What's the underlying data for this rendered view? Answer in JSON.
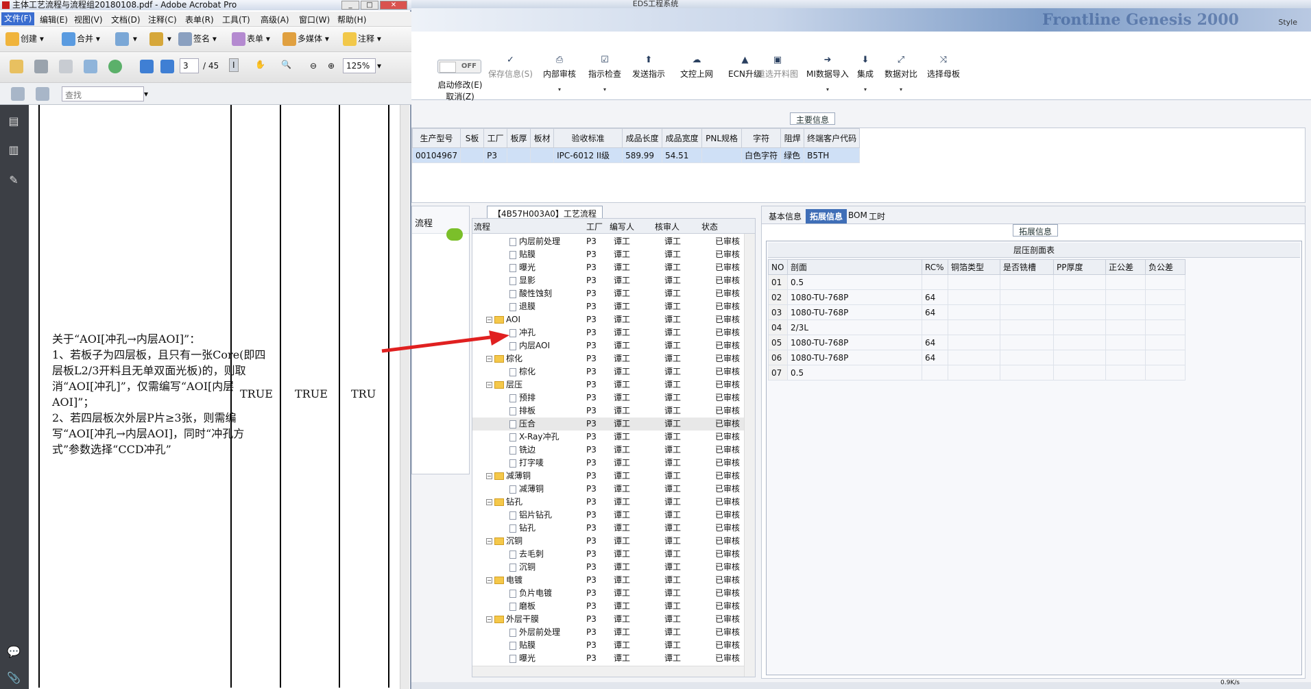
{
  "acrobat": {
    "title": "主体工艺流程与流程组20180108.pdf - Adobe Acrobat Pro",
    "menus": [
      "文件(F)",
      "编辑(E)",
      "视图(V)",
      "文档(D)",
      "注释(C)",
      "表单(R)",
      "工具(T)",
      "高级(A)",
      "窗口(W)",
      "帮助(H)"
    ],
    "toolbar1": {
      "create": "创建",
      "merge": "合并",
      "sign": "签名",
      "form": "表单",
      "multimedia": "多媒体",
      "comment": "注释"
    },
    "toolbar2": {
      "page_current": "3",
      "page_total": "/ 45",
      "zoom": "125%"
    },
    "toolbar3": {
      "find_placeholder": "查找"
    },
    "doc": {
      "text": "关于“AOI[冲孔→内层AOI]”：\n1、若板子为四层板，且只有一张Core(即四层板L2/3开料且无单双面光板)的，则取消“AOI[冲孔]”，仅需编写“AOI[内层AOI]”；\n2、若四层板次外层P片≥3张，则需编写“AOI[冲孔→内层AOI]，同时“冲孔方式”参数选择“CCD冲孔”",
      "col1": "TRUE",
      "col2": "TRUE",
      "col3": "TRU"
    }
  },
  "eds": {
    "title": "EDS工程系统",
    "banner_brand": "Frontline Genesis 2000",
    "banner_style": "Style",
    "toggle": "OFF",
    "start_modify": "启动修改(E)",
    "cancel": "取消(Z)",
    "ribbon": [
      {
        "label": "保存信息(S)",
        "disabled": true
      },
      {
        "label": "内部审核",
        "disabled": false
      },
      {
        "label": "指示检查",
        "disabled": false
      },
      {
        "label": "发送指示",
        "disabled": false
      },
      {
        "label": "文控上网",
        "disabled": false
      },
      {
        "label": "ECN升级",
        "disabled": false
      },
      {
        "label": "重选开料图",
        "disabled": true
      },
      {
        "label": "MI数据导入",
        "disabled": false
      },
      {
        "label": "集成",
        "disabled": false
      },
      {
        "label": "数据对比",
        "disabled": false
      },
      {
        "label": "选择母板",
        "disabled": false
      }
    ],
    "main_info": {
      "title": "主要信息",
      "columns": [
        "生产型号",
        "S板",
        "工厂",
        "板厚",
        "板材",
        "验收标准",
        "成品长度",
        "成品宽度",
        "PNL规格",
        "字符",
        "阻焊",
        "终端客户代码"
      ],
      "row": [
        "00104967",
        "",
        "P3",
        "",
        "",
        "IPC-6012 II级",
        "589.99",
        "54.51",
        "",
        "白色字符",
        "绿色",
        "B5TH"
      ]
    },
    "left_pane": {
      "title": "流程"
    },
    "process": {
      "tab": "【4B57H003A0】工艺流程",
      "columns": [
        "流程",
        "工厂",
        "编写人",
        "核审人",
        "状态"
      ],
      "rows": [
        {
          "name": "内层前处理",
          "group": false,
          "factory": "P3",
          "writer": "谭工",
          "reviewer": "谭工",
          "status": "已审核"
        },
        {
          "name": "贴膜",
          "group": false,
          "factory": "P3",
          "writer": "谭工",
          "reviewer": "谭工",
          "status": "已审核"
        },
        {
          "name": "曝光",
          "group": false,
          "factory": "P3",
          "writer": "谭工",
          "reviewer": "谭工",
          "status": "已审核"
        },
        {
          "name": "显影",
          "group": false,
          "factory": "P3",
          "writer": "谭工",
          "reviewer": "谭工",
          "status": "已审核"
        },
        {
          "name": "酸性蚀刻",
          "group": false,
          "factory": "P3",
          "writer": "谭工",
          "reviewer": "谭工",
          "status": "已审核"
        },
        {
          "name": "退膜",
          "group": false,
          "factory": "P3",
          "writer": "谭工",
          "reviewer": "谭工",
          "status": "已审核"
        },
        {
          "name": "AOI",
          "group": true,
          "factory": "P3",
          "writer": "谭工",
          "reviewer": "谭工",
          "status": "已审核"
        },
        {
          "name": "冲孔",
          "group": false,
          "factory": "P3",
          "writer": "谭工",
          "reviewer": "谭工",
          "status": "已审核"
        },
        {
          "name": "内层AOI",
          "group": false,
          "factory": "P3",
          "writer": "谭工",
          "reviewer": "谭工",
          "status": "已审核"
        },
        {
          "name": "棕化",
          "group": true,
          "factory": "P3",
          "writer": "谭工",
          "reviewer": "谭工",
          "status": "已审核"
        },
        {
          "name": "棕化",
          "group": false,
          "factory": "P3",
          "writer": "谭工",
          "reviewer": "谭工",
          "status": "已审核"
        },
        {
          "name": "层压",
          "group": true,
          "factory": "P3",
          "writer": "谭工",
          "reviewer": "谭工",
          "status": "已审核"
        },
        {
          "name": "预排",
          "group": false,
          "factory": "P3",
          "writer": "谭工",
          "reviewer": "谭工",
          "status": "已审核"
        },
        {
          "name": "排板",
          "group": false,
          "factory": "P3",
          "writer": "谭工",
          "reviewer": "谭工",
          "status": "已审核"
        },
        {
          "name": "压合",
          "group": false,
          "factory": "P3",
          "writer": "谭工",
          "reviewer": "谭工",
          "status": "已审核"
        },
        {
          "name": "X-Ray冲孔",
          "group": false,
          "factory": "P3",
          "writer": "谭工",
          "reviewer": "谭工",
          "status": "已审核"
        },
        {
          "name": "铣边",
          "group": false,
          "factory": "P3",
          "writer": "谭工",
          "reviewer": "谭工",
          "status": "已审核"
        },
        {
          "name": "打字唛",
          "group": false,
          "factory": "P3",
          "writer": "谭工",
          "reviewer": "谭工",
          "status": "已审核"
        },
        {
          "name": "减薄铜",
          "group": true,
          "factory": "P3",
          "writer": "谭工",
          "reviewer": "谭工",
          "status": "已审核"
        },
        {
          "name": "减薄铜",
          "group": false,
          "factory": "P3",
          "writer": "谭工",
          "reviewer": "谭工",
          "status": "已审核"
        },
        {
          "name": "钻孔",
          "group": true,
          "factory": "P3",
          "writer": "谭工",
          "reviewer": "谭工",
          "status": "已审核"
        },
        {
          "name": "铝片钻孔",
          "group": false,
          "factory": "P3",
          "writer": "谭工",
          "reviewer": "谭工",
          "status": "已审核"
        },
        {
          "name": "钻孔",
          "group": false,
          "factory": "P3",
          "writer": "谭工",
          "reviewer": "谭工",
          "status": "已审核"
        },
        {
          "name": "沉铜",
          "group": true,
          "factory": "P3",
          "writer": "谭工",
          "reviewer": "谭工",
          "status": "已审核"
        },
        {
          "name": "去毛刺",
          "group": false,
          "factory": "P3",
          "writer": "谭工",
          "reviewer": "谭工",
          "status": "已审核"
        },
        {
          "name": "沉铜",
          "group": false,
          "factory": "P3",
          "writer": "谭工",
          "reviewer": "谭工",
          "status": "已审核"
        },
        {
          "name": "电镀",
          "group": true,
          "factory": "P3",
          "writer": "谭工",
          "reviewer": "谭工",
          "status": "已审核"
        },
        {
          "name": "负片电镀",
          "group": false,
          "factory": "P3",
          "writer": "谭工",
          "reviewer": "谭工",
          "status": "已审核"
        },
        {
          "name": "磨板",
          "group": false,
          "factory": "P3",
          "writer": "谭工",
          "reviewer": "谭工",
          "status": "已审核"
        },
        {
          "name": "外层干膜",
          "group": true,
          "factory": "P3",
          "writer": "谭工",
          "reviewer": "谭工",
          "status": "已审核"
        },
        {
          "name": "外层前处理",
          "group": false,
          "factory": "P3",
          "writer": "谭工",
          "reviewer": "谭工",
          "status": "已审核"
        },
        {
          "name": "贴膜",
          "group": false,
          "factory": "P3",
          "writer": "谭工",
          "reviewer": "谭工",
          "status": "已审核"
        },
        {
          "name": "曝光",
          "group": false,
          "factory": "P3",
          "writer": "谭工",
          "reviewer": "谭工",
          "status": "已审核"
        }
      ]
    },
    "tabs": [
      "基本信息",
      "拓展信息",
      "BOM",
      "工时"
    ],
    "active_tab": "拓展信息",
    "ext_title": "拓展信息",
    "stack": {
      "title": "层压剖面表",
      "columns": [
        "NO",
        "剖面",
        "RC%",
        "铜箔类型",
        "是否铣槽",
        "PP厚度",
        "正公差",
        "负公差"
      ],
      "rows": [
        [
          "01",
          "0.5",
          "",
          "",
          "",
          "",
          "",
          ""
        ],
        [
          "02",
          "1080-TU-768P",
          "64",
          "",
          "",
          "",
          "",
          ""
        ],
        [
          "03",
          "1080-TU-768P",
          "64",
          "",
          "",
          "",
          "",
          ""
        ],
        [
          "04",
          "2/3L",
          "",
          "",
          "",
          "",
          "",
          ""
        ],
        [
          "05",
          "1080-TU-768P",
          "64",
          "",
          "",
          "",
          "",
          ""
        ],
        [
          "06",
          "1080-TU-768P",
          "64",
          "",
          "",
          "",
          "",
          ""
        ],
        [
          "07",
          "0.5",
          "",
          "",
          "",
          "",
          "",
          ""
        ]
      ]
    },
    "status": {
      "net_speed": "0.9K/s"
    }
  },
  "colors": {
    "accent": "#3f6eb7",
    "arrow": "#e02020",
    "folder": "#f5c84a",
    "selected_row": "#cfe0f6"
  }
}
